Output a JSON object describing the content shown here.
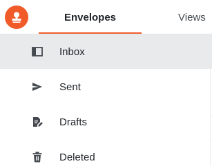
{
  "header": {
    "logo_icon": "stamp-icon",
    "brand_color": "#f15b29",
    "tabs": [
      {
        "label": "Envelopes",
        "active": true
      },
      {
        "label": "Views",
        "active": false
      }
    ]
  },
  "nav": {
    "items": [
      {
        "label": "Inbox",
        "icon": "inbox-icon",
        "selected": true
      },
      {
        "label": "Sent",
        "icon": "send-icon",
        "selected": false
      },
      {
        "label": "Drafts",
        "icon": "drafts-icon",
        "selected": false
      },
      {
        "label": "Deleted",
        "icon": "trash-icon",
        "selected": false
      }
    ]
  },
  "colors": {
    "accent": "#f15b29",
    "selected_bg": "#e9eaeb",
    "icon": "#444a50"
  }
}
